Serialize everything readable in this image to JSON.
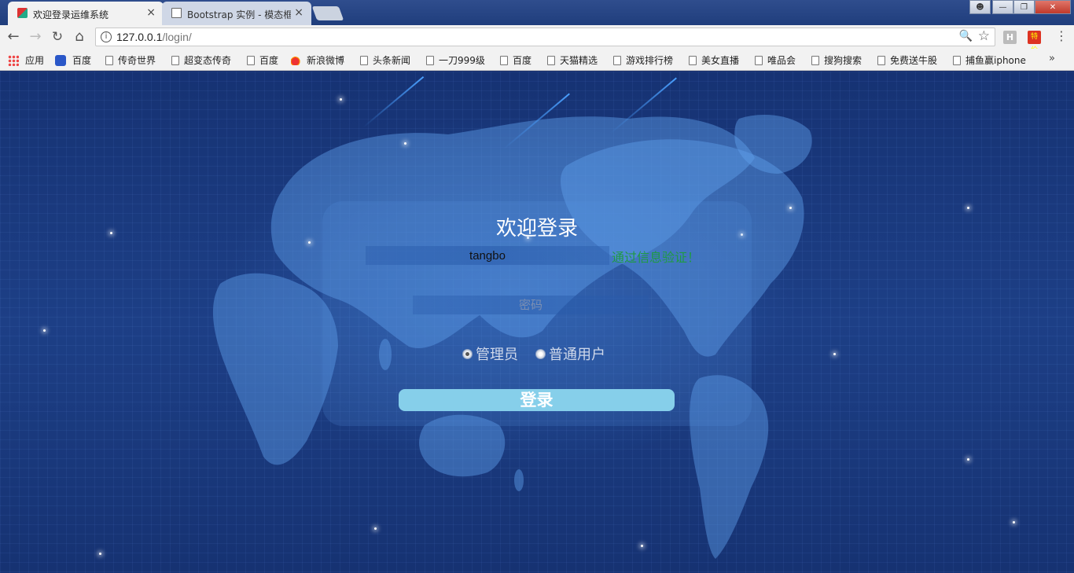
{
  "browser": {
    "tabs": [
      {
        "title": "欢迎登录运维系统",
        "active": true
      },
      {
        "title": "Bootstrap 实例 - 模态框",
        "active": false
      }
    ],
    "close_glyph": "×",
    "url_host": "127.0.0.1",
    "url_path": "/login/",
    "extensions": [
      "H",
      "特价"
    ]
  },
  "bookmarks": [
    {
      "label": "应用",
      "icon": "apps-icon"
    },
    {
      "label": "百度",
      "icon": "paw-icon"
    },
    {
      "label": "传奇世界",
      "icon": "page-icon"
    },
    {
      "label": "超变态传奇",
      "icon": "page-icon"
    },
    {
      "label": "百度",
      "icon": "page-icon"
    },
    {
      "label": "新浪微博",
      "icon": "weibo-icon"
    },
    {
      "label": "头条新闻",
      "icon": "page-icon"
    },
    {
      "label": "一刀999级",
      "icon": "page-icon"
    },
    {
      "label": "百度",
      "icon": "page-icon"
    },
    {
      "label": "天猫精选",
      "icon": "page-icon"
    },
    {
      "label": "游戏排行榜",
      "icon": "page-icon"
    },
    {
      "label": "美女直播",
      "icon": "page-icon"
    },
    {
      "label": "唯品会",
      "icon": "page-icon"
    },
    {
      "label": "搜狗搜索",
      "icon": "page-icon"
    },
    {
      "label": "免费送牛股",
      "icon": "page-icon"
    },
    {
      "label": "捕鱼赢iphone",
      "icon": "page-icon"
    }
  ],
  "login": {
    "title": "欢迎登录",
    "username_value": "tangbo",
    "username_message": "通过信息验证！",
    "password_placeholder": "密码",
    "roles": [
      {
        "label": "管理员",
        "checked": true
      },
      {
        "label": "普通用户",
        "checked": false
      }
    ],
    "submit_label": "登录"
  },
  "colors": {
    "success_text": "#1f9a45",
    "button_bg": "#86cfea",
    "page_bg": "#1d3f86"
  }
}
